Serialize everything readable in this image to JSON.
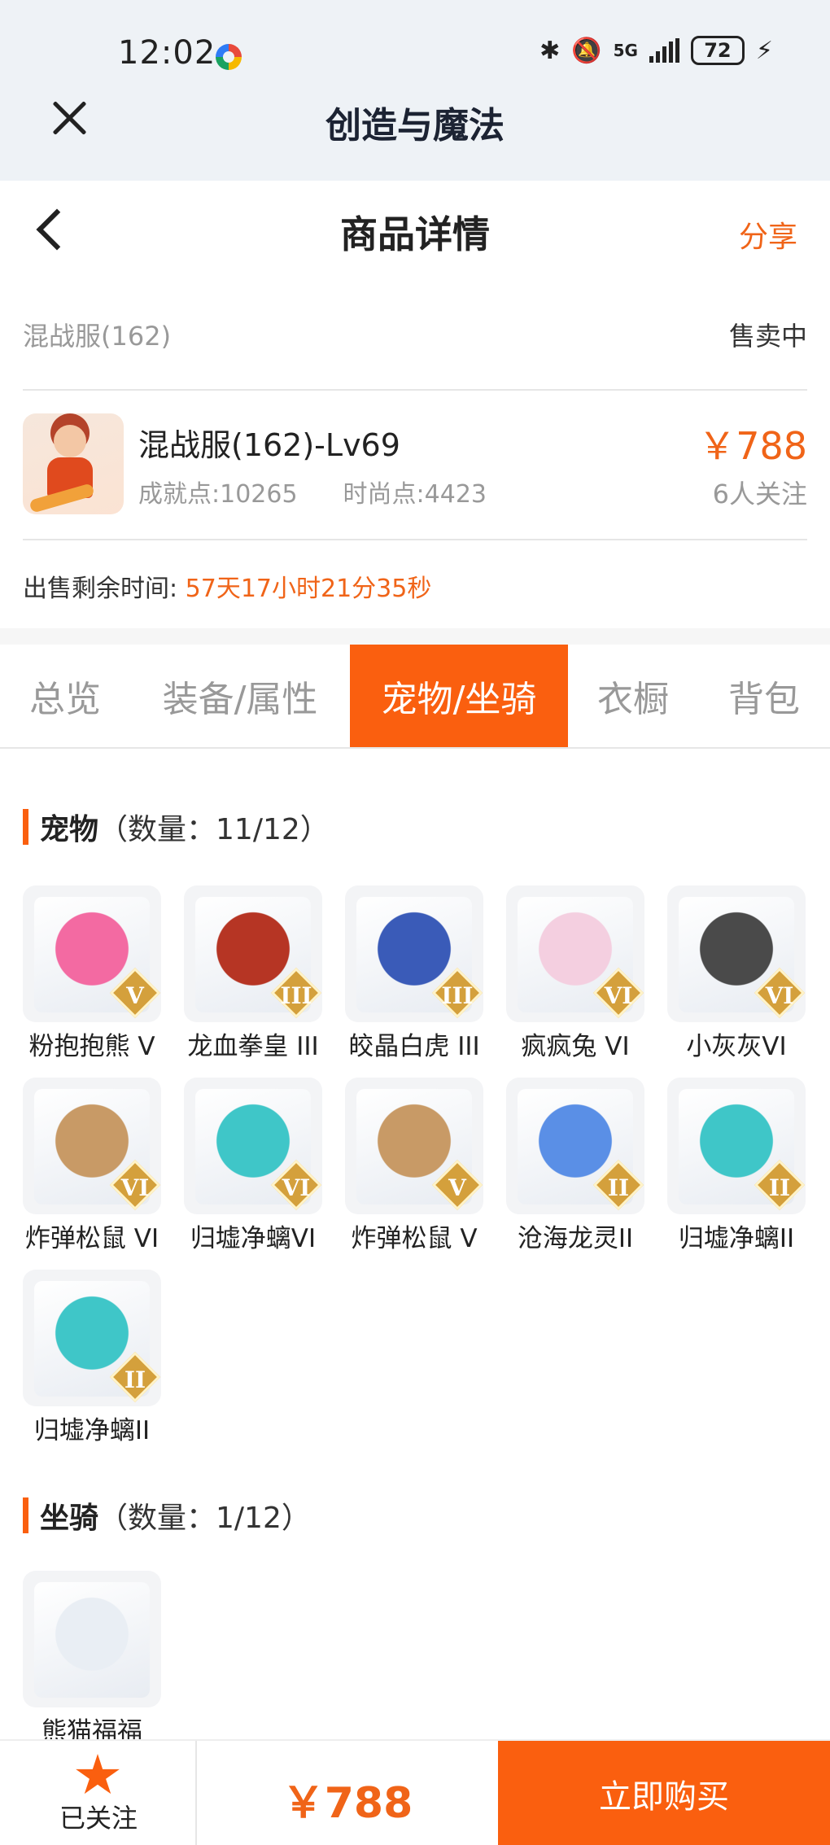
{
  "status_bar": {
    "time": "12:02",
    "battery": "72",
    "network": "5G"
  },
  "app": {
    "title": "创造与魔法"
  },
  "header": {
    "title": "商品详情",
    "share": "分享"
  },
  "listing": {
    "server": "混战服(162)",
    "status": "售卖中",
    "name": "混战服(162)-Lv69",
    "achievement": "成就点:10265",
    "fashion": "时尚点:4423",
    "price": "￥788",
    "watchers": "6人关注",
    "remaining_label": "出售剩余时间:",
    "remaining_value": "57天17小时21分35秒"
  },
  "tabs": [
    "总览",
    "装备/属性",
    "宠物/坐骑",
    "衣橱",
    "背包"
  ],
  "active_tab": "宠物/坐骑",
  "pets": {
    "title": "宠物",
    "count": "（数量：11/12）",
    "items": [
      {
        "name": "粉抱抱熊 V",
        "rank": "V",
        "color": "#f36aa2"
      },
      {
        "name": "龙血拳皇 III",
        "rank": "III",
        "color": "#b63524"
      },
      {
        "name": "皎晶白虎 III",
        "rank": "III",
        "color": "#3a5bb8"
      },
      {
        "name": "疯疯兔 VI",
        "rank": "VI",
        "color": "#f4cfe0"
      },
      {
        "name": "小灰灰VI",
        "rank": "VI",
        "color": "#4a4a4a"
      },
      {
        "name": "炸弹松鼠 VI",
        "rank": "VI",
        "color": "#c89a66"
      },
      {
        "name": "归墟净螭VI",
        "rank": "VI",
        "color": "#3fc6c8"
      },
      {
        "name": "炸弹松鼠 V",
        "rank": "V",
        "color": "#c89a66"
      },
      {
        "name": "沧海龙灵II",
        "rank": "II",
        "color": "#5a8fe6"
      },
      {
        "name": "归墟净螭II",
        "rank": "II",
        "color": "#3fc6c8"
      },
      {
        "name": "归墟净螭II",
        "rank": "II",
        "color": "#3fc6c8"
      }
    ]
  },
  "mounts": {
    "title": "坐骑",
    "count": "（数量：1/12）",
    "items": [
      {
        "name": "熊猫福福",
        "rank": "",
        "color": "#e9eef4"
      }
    ]
  },
  "bottom": {
    "follow": "已关注",
    "price": "￥788",
    "buy": "立即购买"
  },
  "colors": {
    "accent": "#fa5f0f",
    "price": "#f06418"
  }
}
